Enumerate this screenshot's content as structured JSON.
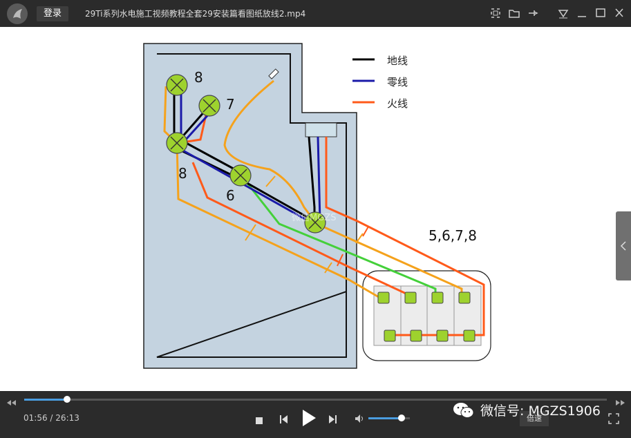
{
  "titlebar": {
    "login_label": "登录",
    "title": "29Ti系列水电施工视频教程全套29安装篇看图纸放线2.mp4",
    "icons": [
      "capture-icon",
      "folder-icon",
      "pin-icon",
      "menu-triangle-icon",
      "minimize-icon",
      "maximize-icon",
      "close-icon"
    ]
  },
  "diagram": {
    "legend": [
      {
        "label": "地线",
        "color": "#000000"
      },
      {
        "label": "零线",
        "color": "#1a1aa8"
      },
      {
        "label": "火线",
        "color": "#ff5a1a"
      }
    ],
    "lamp_labels": [
      "8",
      "7",
      "8",
      "6"
    ],
    "switch_label": "5,6,7,8",
    "watermark_text": "微信MGZS"
  },
  "colors": {
    "ground": "#000000",
    "neutral": "#1a1aa8",
    "live": "#ff5a1a",
    "control": "#f5a21c",
    "green_wire": "#44d03a",
    "wall": "#c4d3e0",
    "lamp": "#9ed22e"
  },
  "player": {
    "progress_fraction": 0.074,
    "current_time": "01:56",
    "total_time": "26:13",
    "time_separator": "/",
    "volume_fraction": 0.8,
    "speed_label": "倍速",
    "watermark": "微信号: MGZS1906"
  }
}
